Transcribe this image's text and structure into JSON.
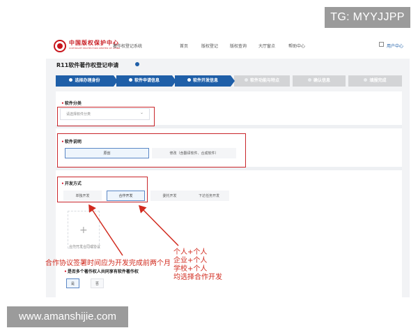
{
  "tg_badge": "TG: MYYJJPP",
  "watermark": "www.amanshijie.com",
  "header": {
    "logo_cn": "中国版权保护中心",
    "logo_en": "COPYRIGHT PROTECTION CENTER OF CHINA",
    "system_name": "著作权登记系统",
    "nav": [
      "首页",
      "版权登记",
      "版权查询",
      "大厅窗点",
      "帮助中心"
    ],
    "user": "用户中心"
  },
  "page": {
    "title": "R11软件著作权登记申请"
  },
  "steps": [
    {
      "label": "选择办理身份",
      "active": true
    },
    {
      "label": "软件申请信息",
      "active": true
    },
    {
      "label": "软件开发信息",
      "active": true
    },
    {
      "label": "软件功能与特点",
      "active": false
    },
    {
      "label": "确认信息",
      "active": false
    },
    {
      "label": "填报完成",
      "active": false
    }
  ],
  "form": {
    "category": {
      "label": "软件分类",
      "placeholder": "请选择软件分类"
    },
    "description": {
      "label": "软件说明",
      "options": [
        "原创",
        "修改（含翻译软件、合成软件）"
      ],
      "selected": "原创"
    },
    "dev_mode": {
      "label": "开发方式",
      "options": [
        "单独开发",
        "合作开发",
        "委托开发",
        "下达任务开发"
      ],
      "selected": "合作开发"
    },
    "upload_caption": "合作开发合同或协议",
    "multi_owner": {
      "label": "是否多个著作权人共同享有软件著作权",
      "options": [
        "是",
        "否"
      ],
      "selected": "是"
    }
  },
  "annotations": {
    "note_left": "合作协议签署时间应为开发完成前两个月",
    "note_right": [
      "个人+个人",
      "企业+个人",
      "学校+个人",
      "均选择合作开发"
    ]
  },
  "colors": {
    "primary": "#1f5fa8",
    "annotation_red": "#d12a1e",
    "step_inactive": "#d3d4d6"
  }
}
